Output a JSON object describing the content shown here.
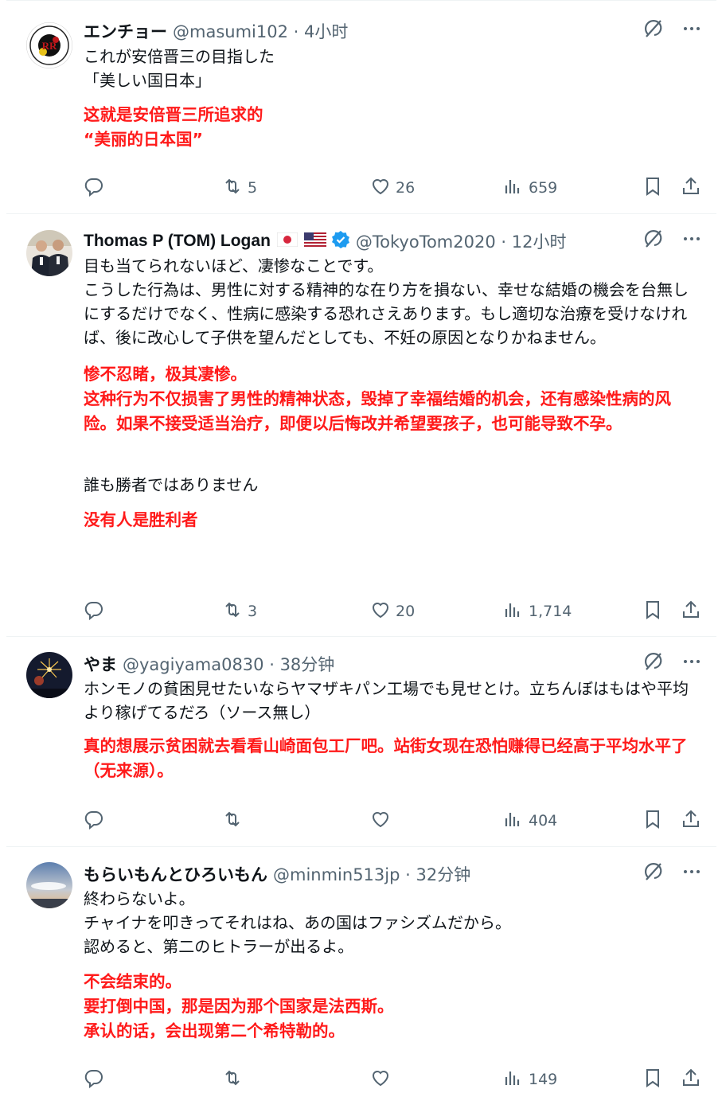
{
  "tweets": [
    {
      "author": {
        "name": "エンチョー",
        "handle": "@masumi102",
        "time": "4小时"
      },
      "text_ja": [
        "これが安倍晋三の目指した",
        "「美しい国日本」"
      ],
      "text_zh": [
        "这就是安倍晋三所追求的",
        "“美丽的日本国”"
      ],
      "stats": {
        "replies": "",
        "retweets": "5",
        "likes": "26",
        "views": "659"
      }
    },
    {
      "author": {
        "name": "Thomas P (TOM) Logan",
        "handle": "@TokyoTom2020",
        "time": "12小时",
        "flags": [
          "japan-flag",
          "us-flag"
        ],
        "verified": true
      },
      "text_ja": [
        "目も当てられないほど、凄惨なことです。",
        "こうした行為は、男性に対する精神的な在り方を損ない、幸せな結婚の機会を台無しにするだけでなく、性病に感染する恐れさえあります。もし適切な治療を受けなければ、後に改心して子供を望んだとしても、不妊の原因となりかねません。"
      ],
      "text_zh": [
        "惨不忍睹，极其凄惨。",
        "这种行为不仅损害了男性的精神状态，毁掉了幸福结婚的机会，还有感染性病的风险。如果不接受适当治疗，即便以后悔改并希望要孩子，也可能导致不孕。"
      ],
      "text_ja2": [
        "誰も勝者ではありません"
      ],
      "text_zh2": [
        "没有人是胜利者"
      ],
      "stats": {
        "replies": "",
        "retweets": "3",
        "likes": "20",
        "views": "1,714"
      }
    },
    {
      "author": {
        "name": "やま",
        "handle": "@yagiyama0830",
        "time": "38分钟"
      },
      "text_ja": [
        "ホンモノの貧困見せたいならヤマザキパン工場でも見せとけ。立ちんぼはもはや平均より稼げてるだろ（ソース無し）"
      ],
      "text_zh": [
        "真的想展示贫困就去看看山崎面包工厂吧。站街女现在恐怕赚得已经高于平均水平了（无来源）。"
      ],
      "stats": {
        "replies": "",
        "retweets": "",
        "likes": "",
        "views": "404"
      }
    },
    {
      "author": {
        "name": "もらいもんとひろいもん",
        "handle": "@minmin513jp",
        "time": "32分钟"
      },
      "text_ja": [
        "終わらないよ。",
        "チャイナを叩きってそれはね、あの国はファシズムだから。",
        "認めると、第二のヒトラーが出るよ。"
      ],
      "text_zh": [
        "不会结束的。",
        "要打倒中国，那是因为那个国家是法西斯。",
        "承认的话，会出现第二个希特勒的。"
      ],
      "stats": {
        "replies": "",
        "retweets": "",
        "likes": "",
        "views": "149"
      }
    }
  ],
  "sep": " · ",
  "icons": {
    "grok": "grok-icon",
    "more": "more-icon",
    "reply": "reply-icon",
    "retweet": "retweet-icon",
    "like": "like-icon",
    "views": "views-icon",
    "bookmark": "bookmark-icon",
    "share": "share-icon"
  },
  "colors": {
    "text": "#0f1419",
    "muted": "#536471",
    "red_annotation": "#ff1a1a",
    "verified": "#1d9bf0",
    "divider": "#eff3f4"
  }
}
